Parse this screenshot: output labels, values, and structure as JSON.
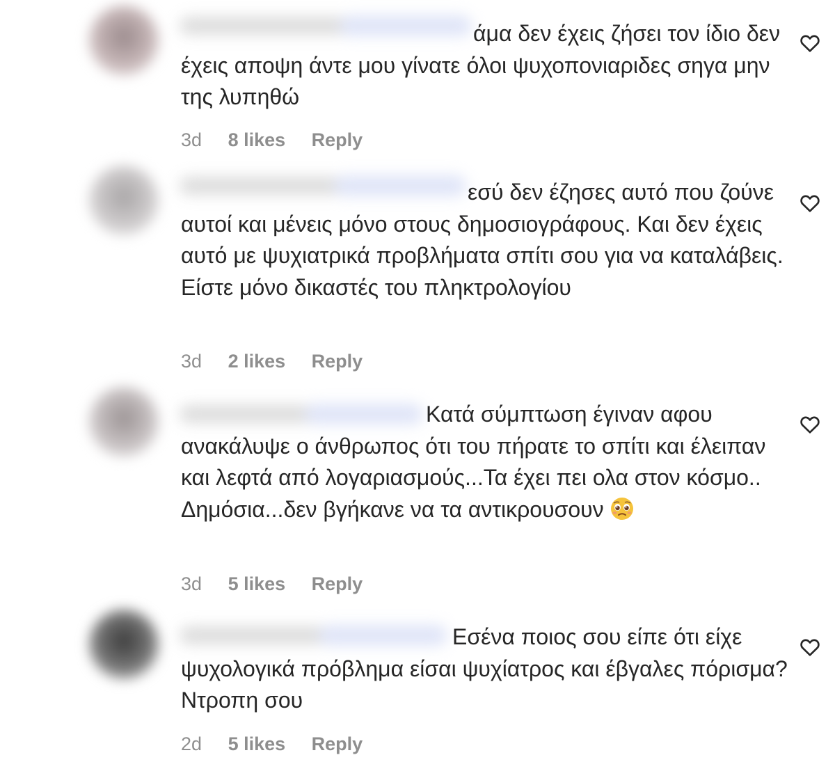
{
  "comments": [
    {
      "text": "άμα δεν έχεις ζήσει τον ίδιο δεν έχεις αποψη άντε μου γίνατε όλοι ψυχοπονιαριδες σηγα μην της λυπηθώ",
      "time": "3d",
      "likes": "8 likes",
      "reply": "Reply"
    },
    {
      "text": "εσύ δεν έζησες αυτό που ζούνε αυτοί και μένεις μόνο στους δημοσιογράφους. Και δεν έχεις αυτό με ψυχιατρικά προβλήματα σπίτι σου για να καταλάβεις. Είστε μόνο δικαστές του πληκτρολογίου",
      "time": "3d",
      "likes": "2 likes",
      "reply": "Reply"
    },
    {
      "text": "Κατά σύμπτωση έγιναν αφου ανακάλυψε ο άνθρωπος ότι του πήρατε το σπίτι και έλειπαν και λεφτά από λογαριασμούς...Τα έχει πει ολα στον κόσμο.. Δημόσια...δεν βγήκανε να τα αντικρουσουν",
      "emoji": "pleading-face-emoji",
      "time": "3d",
      "likes": "5 likes",
      "reply": "Reply"
    },
    {
      "text": "Εσένα ποιος σου είπε ότι είχε ψυχολογικά πρόβλημα είσαι ψυχίατρος και έβγαλες πόρισμα? Ντροπη σου",
      "time": "2d",
      "likes": "5 likes",
      "reply": "Reply"
    }
  ],
  "icons": {
    "like": "heart-outline-icon"
  },
  "colors": {
    "text": "#262626",
    "meta": "#8e8e8e",
    "background": "#ffffff"
  }
}
